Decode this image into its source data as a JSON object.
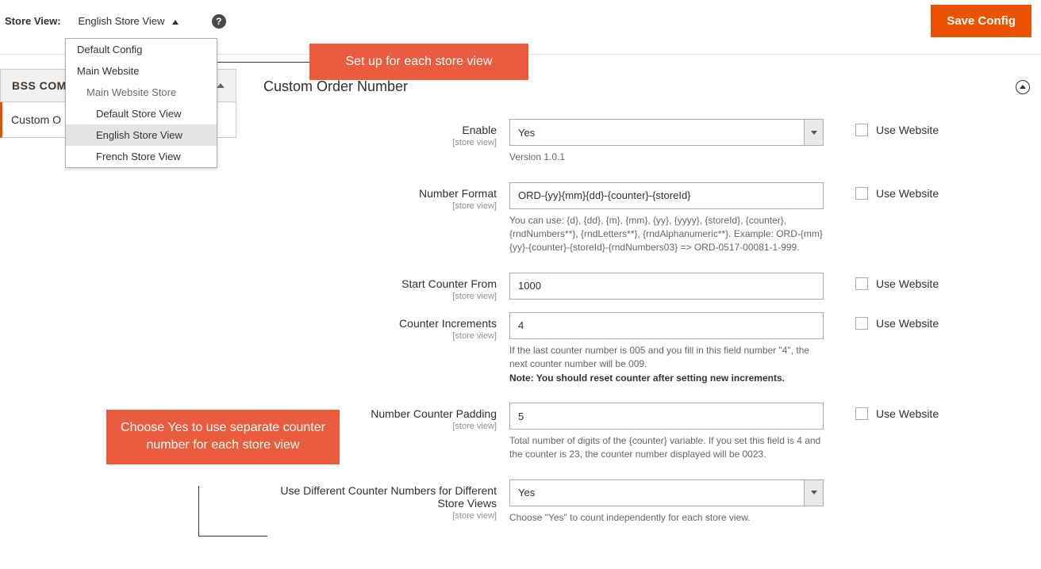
{
  "topbar": {
    "store_view_label": "Store View:",
    "store_view_value": "English Store View",
    "save_button": "Save Config"
  },
  "dropdown": {
    "items": [
      {
        "text": "Default Config",
        "level": 1
      },
      {
        "text": "Main Website",
        "level": 1
      },
      {
        "text": "Main Website Store",
        "level": 2,
        "disabled": true
      },
      {
        "text": "Default Store View",
        "level": 3
      },
      {
        "text": "English Store View",
        "level": 3,
        "selected": true
      },
      {
        "text": "French Store View",
        "level": 3
      }
    ]
  },
  "sidebar": {
    "group": "BSS COMM",
    "active_item": "Custom O"
  },
  "callouts": {
    "top": "Set up for each store view",
    "left": "Choose Yes to use separate counter number for each store view"
  },
  "section": {
    "title": "Custom Order Number",
    "scope_text": "[store view]",
    "use_website_label": "Use Website",
    "fields": {
      "enable": {
        "label": "Enable",
        "value": "Yes",
        "note": "Version 1.0.1"
      },
      "number_format": {
        "label": "Number Format",
        "value": "ORD-{yy}{mm}{dd}-{counter}-{storeId}",
        "note": "You can use: {d}, {dd}, {m}, {mm}, {yy}, {yyyy}, {storeId}, {counter}, {rndNumbers**}, {rndLetters**}, {rndAlphanumeric**}. Example: ORD-{mm}{yy}-{counter}-{storeId}-{rndNumbers03} => ORD-0517-00081-1-999."
      },
      "start_counter": {
        "label": "Start Counter From",
        "value": "1000"
      },
      "counter_increments": {
        "label": "Counter Increments",
        "value": "4",
        "note_a": "If the last counter number is 005 and you fill in this field number \"4\", the next counter number will be 009.",
        "note_b": "Note: You should reset counter after setting new increments."
      },
      "counter_padding": {
        "label": "Number Counter Padding",
        "value": "5",
        "note": "Total number of digits of the {counter} variable. If you set this field is 4 and the counter is 23, the counter number displayed will be 0023."
      },
      "diff_counter": {
        "label": "Use Different Counter Numbers for Different Store Views",
        "value": "Yes",
        "note": "Choose \"Yes\" to count independently for each store view."
      }
    }
  }
}
